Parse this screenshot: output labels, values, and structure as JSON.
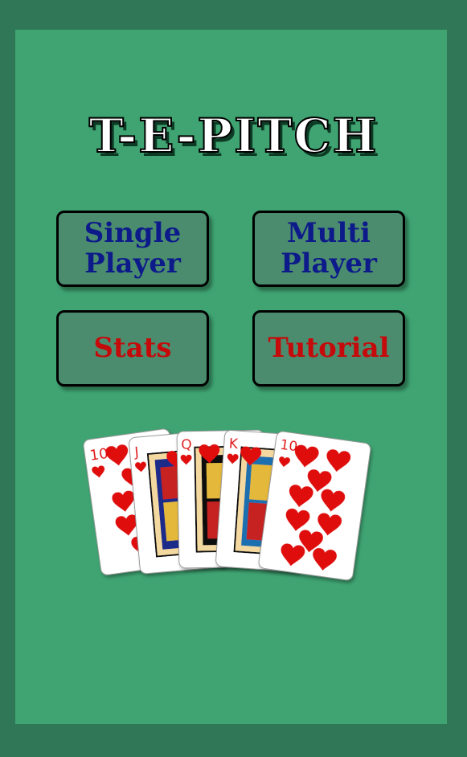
{
  "title": "T-E-PITCH",
  "menu": {
    "single_line1": "Single",
    "single_line2": "Player",
    "multi_line1": "Multi",
    "multi_line2": "Player",
    "stats": "Stats",
    "tutorial": "Tutorial"
  },
  "hand": {
    "cards": [
      {
        "rank": "10",
        "suit": "hearts"
      },
      {
        "rank": "J",
        "suit": "hearts"
      },
      {
        "rank": "Q",
        "suit": "hearts"
      },
      {
        "rank": "K",
        "suit": "hearts"
      },
      {
        "rank": "10",
        "suit": "hearts"
      }
    ]
  },
  "colors": {
    "felt": "#3fa472",
    "frame": "#2f7756",
    "button_bg": "#4c8c6e",
    "blue_text": "#0d1b8a",
    "red_text": "#c40a0a",
    "heart_red": "#e01010"
  }
}
